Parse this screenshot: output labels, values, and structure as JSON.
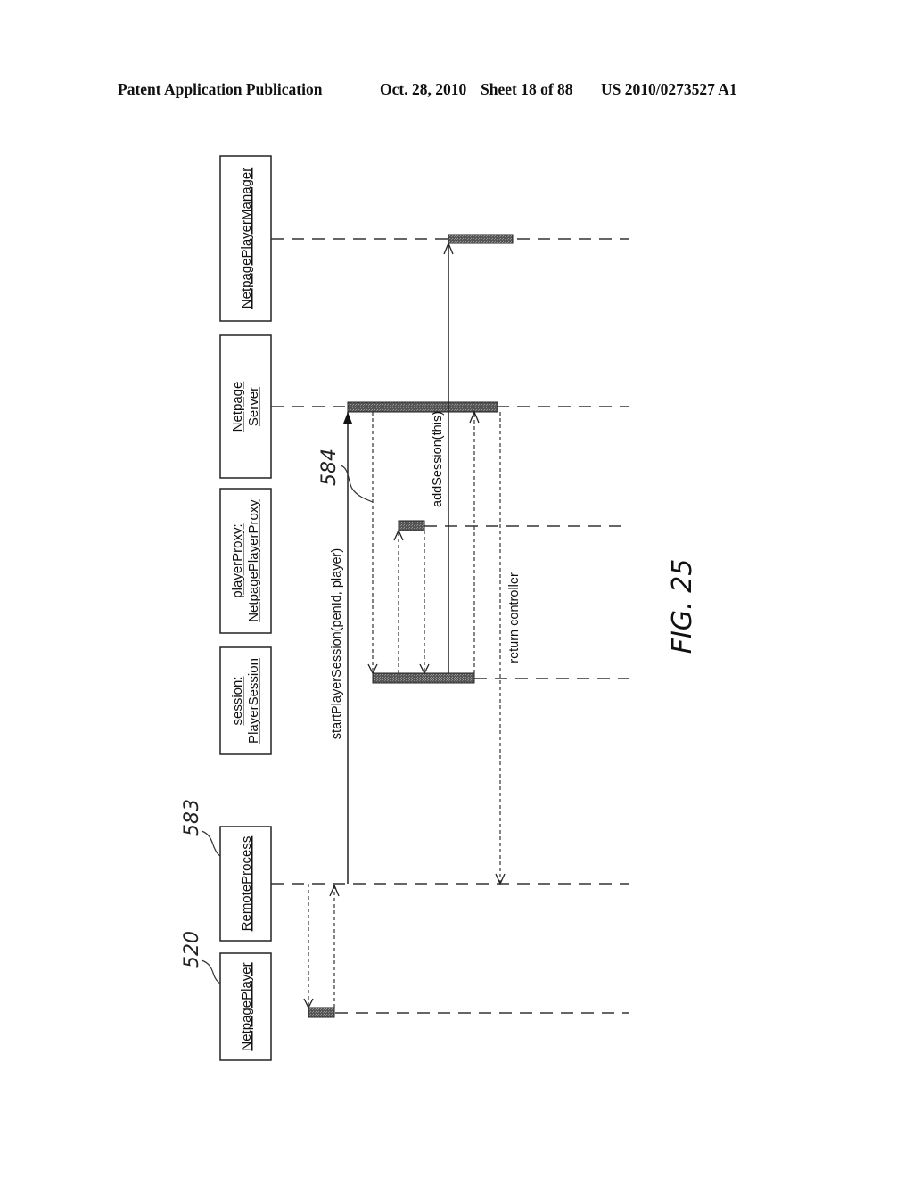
{
  "header": {
    "left": "Patent Application Publication",
    "date": "Oct. 28, 2010",
    "sheet": "Sheet 18 of 88",
    "number": "US 2010/0273527 A1"
  },
  "figure": {
    "label": "FIG. 25",
    "objects": [
      {
        "id": "netpagePlayerManager",
        "lines": [
          "NetpagePlayerManager"
        ]
      },
      {
        "id": "netpageServer",
        "lines": [
          "Netpage",
          "Server"
        ]
      },
      {
        "id": "playerProxy",
        "lines": [
          "playerProxy:",
          "NetpagePlayerProxy"
        ]
      },
      {
        "id": "session",
        "lines": [
          "session:",
          "PlayerSession"
        ]
      },
      {
        "id": "remoteProcess",
        "lines": [
          "RemoteProcess"
        ],
        "ref": "583"
      },
      {
        "id": "netpagePlayer",
        "lines": [
          "NetpagePlayer"
        ],
        "ref": "520"
      }
    ],
    "messages": [
      {
        "id": "startPlayerSession",
        "label": "startPlayerSession(penId, player)",
        "from": "remoteProcess",
        "to": "netpageServer",
        "style": "solid",
        "ref": "584"
      },
      {
        "id": "addSession",
        "label": "addSession(this)",
        "from": "session",
        "to": "netpagePlayerManager",
        "style": "solid"
      },
      {
        "id": "returnController",
        "label": "return controller",
        "from": "netpageServer",
        "to": "remoteProcess",
        "style": "dashed"
      }
    ]
  }
}
